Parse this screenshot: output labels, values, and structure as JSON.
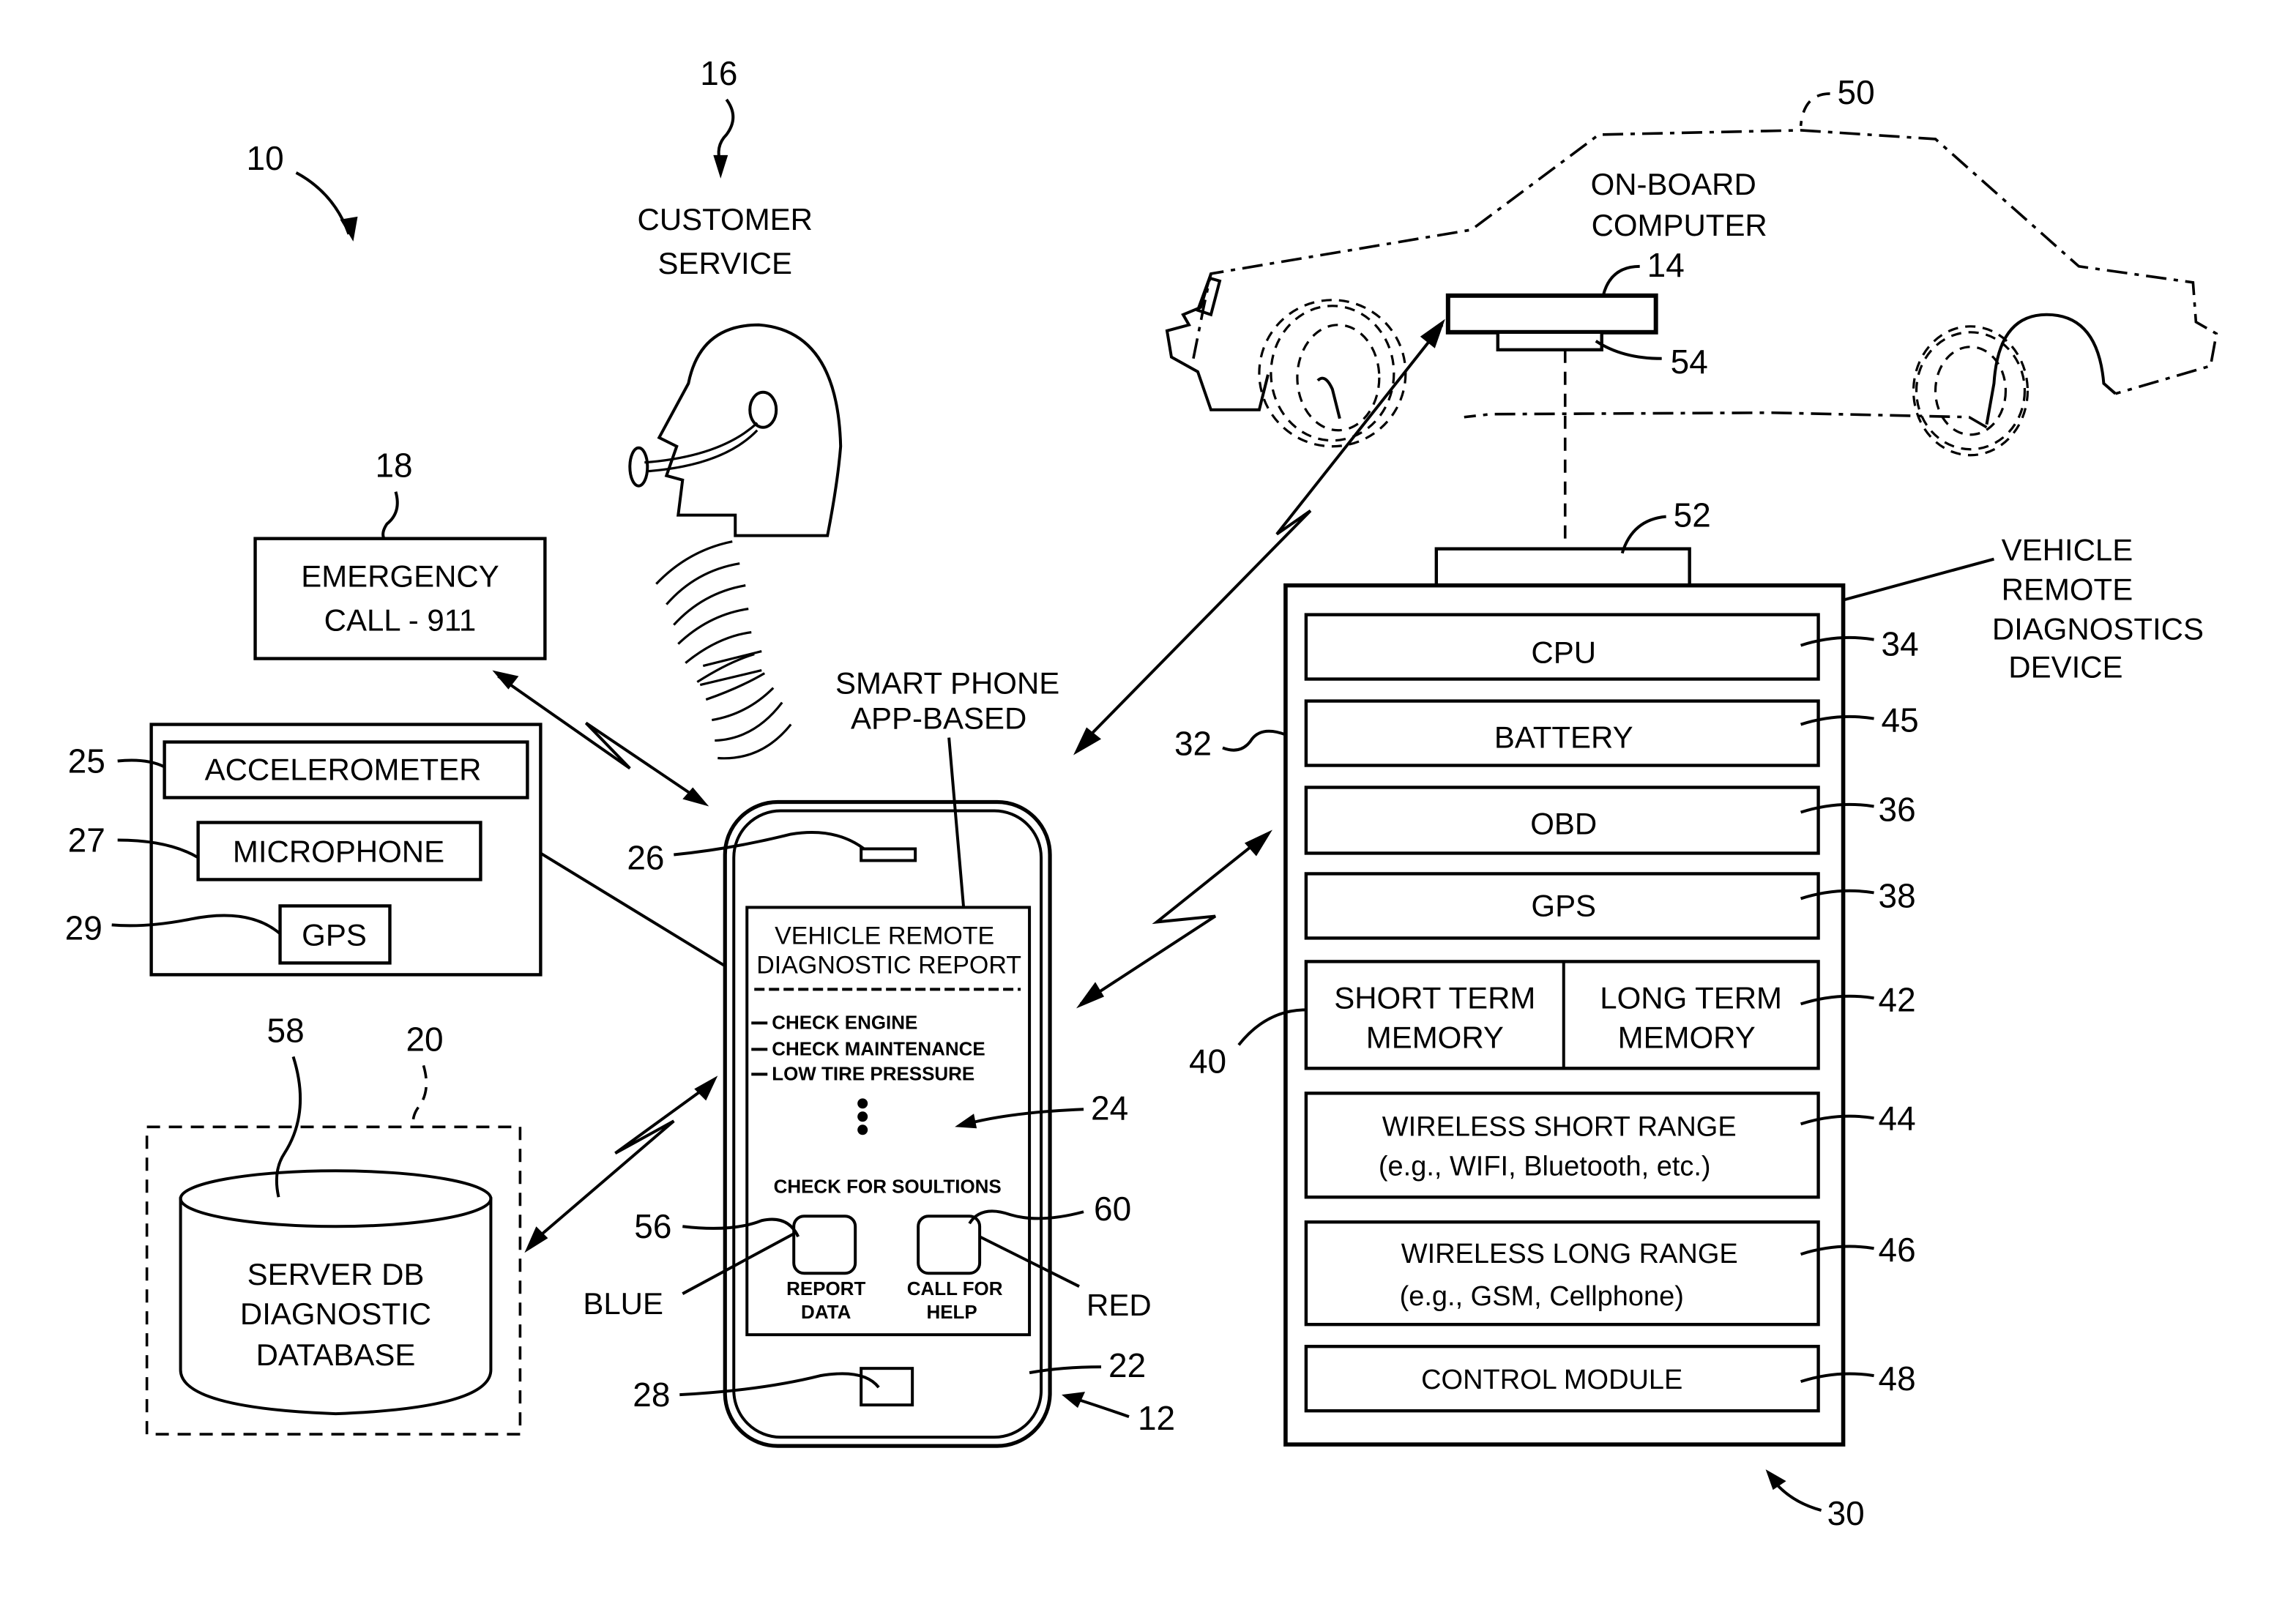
{
  "figure": {
    "system_ref": "10",
    "customer_service": {
      "ref": "16",
      "line1": "CUSTOMER",
      "line2": "SERVICE"
    },
    "emergency": {
      "ref": "18",
      "line1": "EMERGENCY",
      "line2": "CALL - 911"
    },
    "sensors": {
      "items": [
        {
          "ref": "25",
          "label": "ACCELEROMETER"
        },
        {
          "ref": "27",
          "label": "MICROPHONE"
        },
        {
          "ref": "29",
          "label": "GPS"
        }
      ]
    },
    "server": {
      "ref_box": "20",
      "ref_db": "58",
      "line1": "SERVER DB",
      "line2": "DIAGNOSTIC",
      "line3": "DATABASE"
    },
    "smartphone": {
      "ref": "12",
      "ref_body": "22",
      "ref_screen": "24",
      "ref_speaker": "26",
      "ref_home": "28",
      "caption_line1": "SMART PHONE",
      "caption_line2": "APP-BASED",
      "screen_title_line1": "VEHICLE REMOTE",
      "screen_title_line2": "DIAGNOSTIC REPORT",
      "report_items": [
        "CHECK ENGINE",
        "CHECK MAINTENANCE",
        "LOW TIRE PRESSURE"
      ],
      "solutions_label": "CHECK FOR SOULTIONS",
      "buttons": [
        {
          "ref": "56",
          "color_name": "BLUE",
          "line1": "REPORT",
          "line2": "DATA"
        },
        {
          "ref": "60",
          "color_name": "RED",
          "line1": "CALL FOR",
          "line2": "HELP"
        }
      ]
    },
    "vehicle": {
      "ref": "50",
      "onboard_line1": "ON-BOARD",
      "onboard_line2": "COMPUTER",
      "onboard_ref": "14",
      "port_ref": "54"
    },
    "device": {
      "ref": "30",
      "ref_housing": "32",
      "ref_connector": "52",
      "title_lines": [
        "VEHICLE",
        "REMOTE",
        "DIAGNOSTICS",
        "DEVICE"
      ],
      "modules": [
        {
          "ref": "34",
          "label": "CPU"
        },
        {
          "ref": "45",
          "label": "BATTERY"
        },
        {
          "ref": "36",
          "label": "OBD"
        },
        {
          "ref": "38",
          "label": "GPS"
        }
      ],
      "memory": {
        "ref_group": "40",
        "ref": "42",
        "short_line1": "SHORT TERM",
        "short_line2": "MEMORY",
        "long_line1": "LONG TERM",
        "long_line2": "MEMORY"
      },
      "wireless_short": {
        "ref": "44",
        "line1": "WIRELESS SHORT RANGE",
        "line2": "(e.g., WIFI, Bluetooth, etc.)"
      },
      "wireless_long": {
        "ref": "46",
        "line1": "WIRELESS LONG RANGE",
        "line2": "(e.g., GSM, Cellphone)"
      },
      "control": {
        "ref": "48",
        "label": "CONTROL MODULE"
      }
    }
  }
}
